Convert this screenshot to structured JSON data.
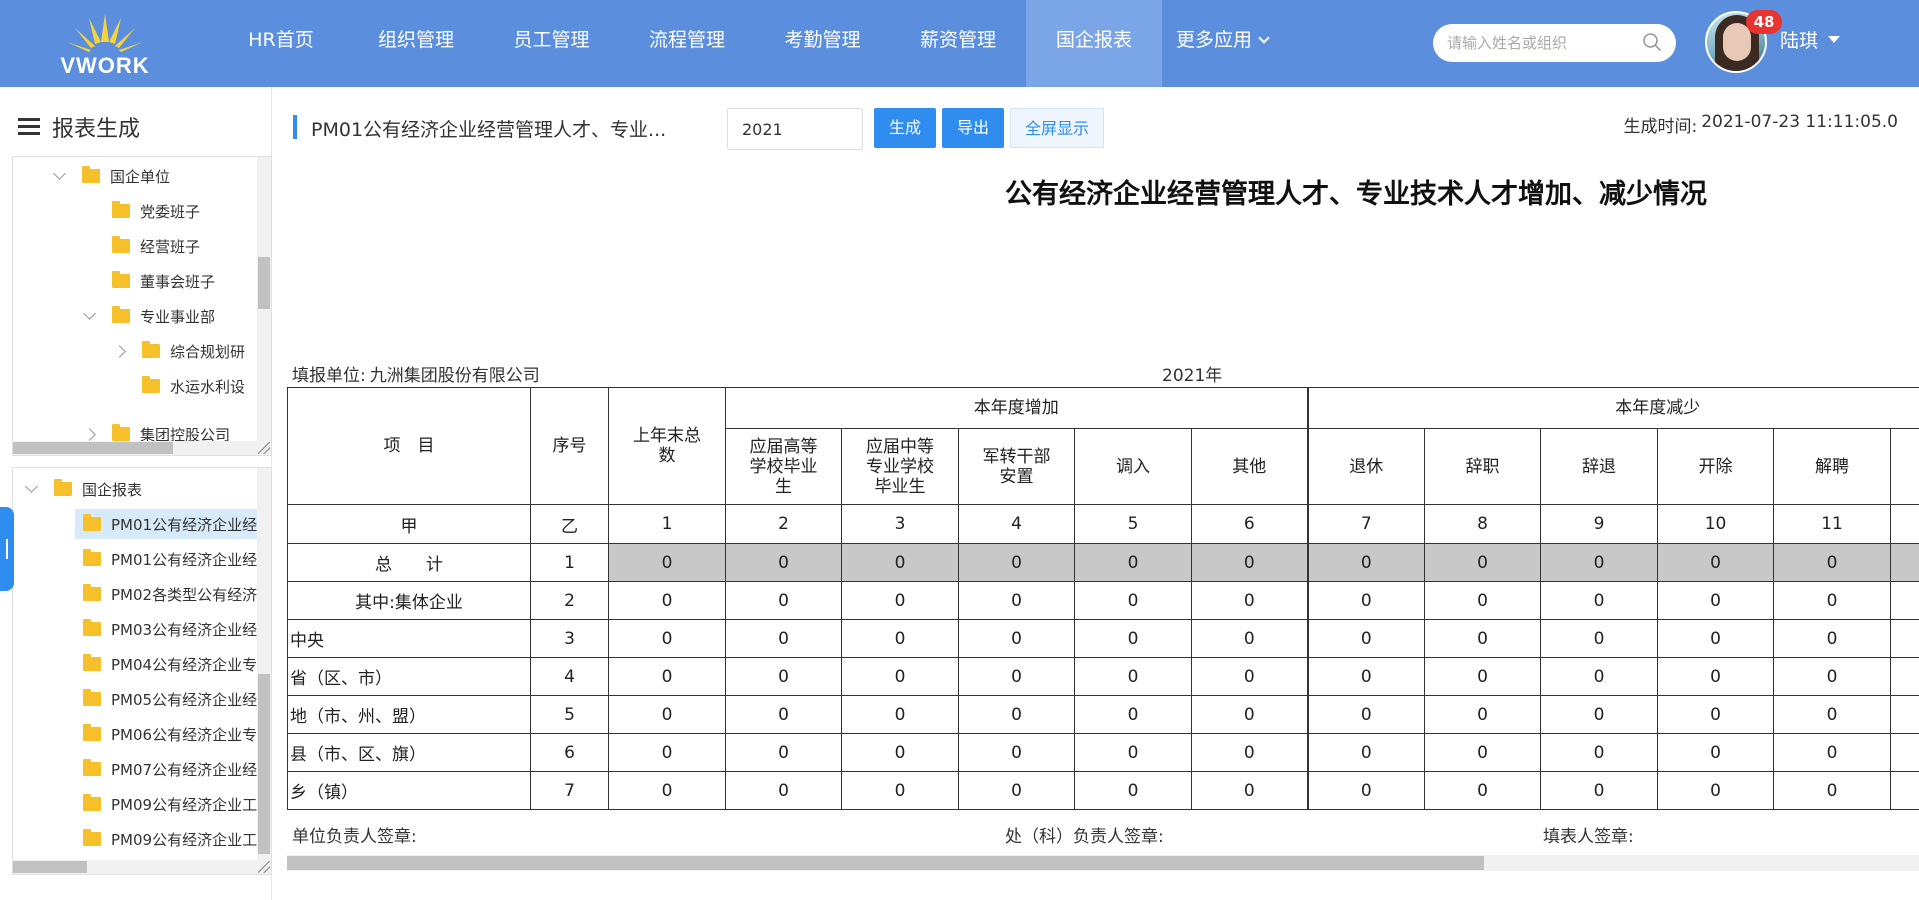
{
  "brand": {
    "logo_text": "VWORK"
  },
  "nav": {
    "items": [
      "HR首页",
      "组织管理",
      "员工管理",
      "流程管理",
      "考勤管理",
      "薪资管理",
      "国企报表"
    ],
    "active_index": 6,
    "more_label": "更多应用"
  },
  "search": {
    "placeholder": "请输入姓名或组织"
  },
  "user": {
    "name": "陆琪",
    "badge_count": "48"
  },
  "sidebar": {
    "title": "报表生成",
    "org_tree": [
      {
        "label": "国企单位",
        "expanded": true
      },
      {
        "label": "党委班子"
      },
      {
        "label": "经营班子"
      },
      {
        "label": "董事会班子"
      },
      {
        "label": "专业事业部",
        "expanded": true
      },
      {
        "label": "综合规划研",
        "expanded": false
      },
      {
        "label": "水运水利设"
      },
      {
        "label": "集团控股公司",
        "expanded": false
      }
    ],
    "report_tree": [
      {
        "label": "国企报表",
        "expanded": true
      },
      {
        "label": "PM01公有经济企业经",
        "selected": true
      },
      {
        "label": "PM01公有经济企业经"
      },
      {
        "label": "PM02各类型公有经济"
      },
      {
        "label": "PM03公有经济企业经"
      },
      {
        "label": "PM04公有经济企业专"
      },
      {
        "label": "PM05公有经济企业经"
      },
      {
        "label": "PM06公有经济企业专"
      },
      {
        "label": "PM07公有经济企业经"
      },
      {
        "label": "PM09公有经济企业工"
      },
      {
        "label": "PM09公有经济企业工"
      }
    ]
  },
  "toolbar": {
    "report_name": "PM01公有经济企业经营管理人才、专业...",
    "year_value": "2021",
    "generate_label": "生成",
    "export_label": "导出",
    "fullscreen_label": "全屏显示",
    "gen_time_label": "生成时间:",
    "gen_time_value": "2021-07-23 11:11:05.0"
  },
  "report": {
    "title": "公有经济企业经营管理人才、专业技术人才增加、减少情况",
    "fill_unit_label": "填报单位:",
    "fill_unit_value": "九洲集团股份有限公司",
    "year": "2021年",
    "header": {
      "item": "项　目",
      "seq": "序号",
      "last_year_total": "上年末总数",
      "increase_group": "本年度增加",
      "decrease_group": "本年度减少",
      "increase_cols": [
        "应届高等学校毕业生",
        "应届中等专业学校毕业生",
        "军转干部安置",
        "调入",
        "其他"
      ],
      "decrease_cols": [
        "退休",
        "辞职",
        "辞退",
        "开除",
        "解聘"
      ]
    },
    "sub_header": [
      "甲",
      "乙",
      "1",
      "2",
      "3",
      "4",
      "5",
      "6",
      "7",
      "8",
      "9",
      "10",
      "11"
    ],
    "rows": [
      {
        "item": "总　　计",
        "seq": "1",
        "values": [
          "0",
          "0",
          "0",
          "0",
          "0",
          "0",
          "0",
          "0",
          "0",
          "0",
          "0"
        ]
      },
      {
        "item": "其中:集体企业",
        "seq": "2",
        "values": [
          "0",
          "0",
          "0",
          "0",
          "0",
          "0",
          "0",
          "0",
          "0",
          "0",
          "0"
        ]
      },
      {
        "item": "中央",
        "seq": "3",
        "values": [
          "0",
          "0",
          "0",
          "0",
          "0",
          "0",
          "0",
          "0",
          "0",
          "0",
          "0"
        ]
      },
      {
        "item": "省（区、市）",
        "seq": "4",
        "values": [
          "0",
          "0",
          "0",
          "0",
          "0",
          "0",
          "0",
          "0",
          "0",
          "0",
          "0"
        ]
      },
      {
        "item": "地（市、州、盟）",
        "seq": "5",
        "values": [
          "0",
          "0",
          "0",
          "0",
          "0",
          "0",
          "0",
          "0",
          "0",
          "0",
          "0"
        ]
      },
      {
        "item": "县（市、区、旗）",
        "seq": "6",
        "values": [
          "0",
          "0",
          "0",
          "0",
          "0",
          "0",
          "0",
          "0",
          "0",
          "0",
          "0"
        ]
      },
      {
        "item": "乡（镇）",
        "seq": "7",
        "values": [
          "0",
          "0",
          "0",
          "0",
          "0",
          "0",
          "0",
          "0",
          "0",
          "0",
          "0"
        ]
      }
    ],
    "sign_unit": "单位负责人签章:",
    "sign_dept": "处（科）负责人签章:",
    "sign_filler": "填表人签章:"
  },
  "colors": {
    "nav_bg": "#5b8fde",
    "nav_active": "#7aa6e8",
    "accent": "#2f8df0",
    "badge": "#e8342f",
    "folder": "#f5c02a",
    "total_row_bg": "#c8c8c8"
  }
}
